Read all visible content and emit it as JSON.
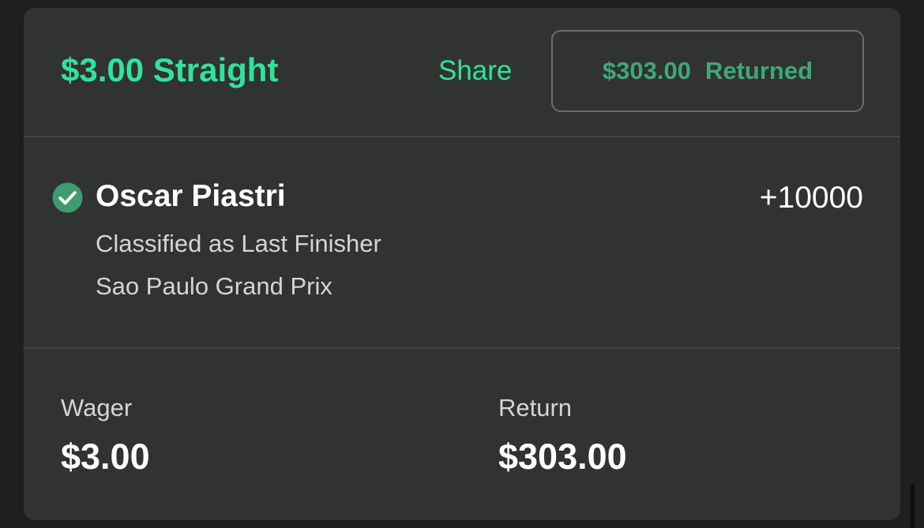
{
  "colors": {
    "page_background": "#1e1f1e",
    "card_background": "#303331",
    "accent_green": "#2fe39c",
    "status_green": "#3fa87a",
    "check_green": "#3f9c6e",
    "divider": "#444845",
    "primary_text": "#ffffff",
    "secondary_text": "#d4d6d4"
  },
  "header": {
    "bet_title": "$3.00 Straight",
    "share_label": "Share",
    "status": {
      "amount": "$303.00",
      "label": "Returned"
    }
  },
  "selection": {
    "status_icon": "check-circle-icon",
    "runner_name": "Oscar Piastri",
    "odds": "+10000",
    "market": "Classified as Last Finisher",
    "event": "Sao Paulo Grand Prix"
  },
  "totals": {
    "wager_label": "Wager",
    "wager_value": "$3.00",
    "return_label": "Return",
    "return_value": "$303.00"
  }
}
